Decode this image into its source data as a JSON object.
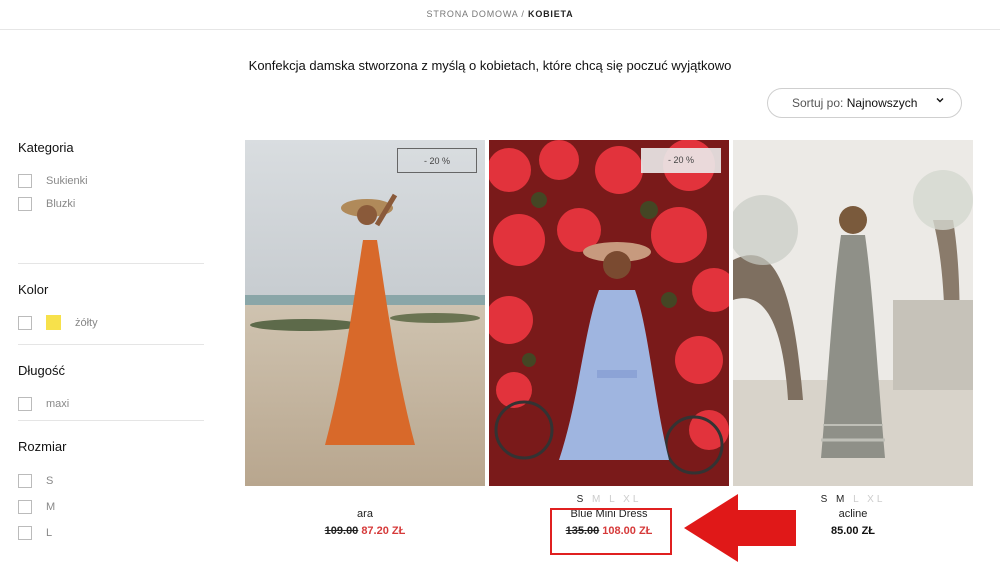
{
  "breadcrumb": {
    "home": "STRONA DOMOWA",
    "separator": "/",
    "current": "KOBIETA"
  },
  "tagline": "Konfekcja damska stworzona z myślą o kobietach, które chcą się poczuć wyjątkowo",
  "sort": {
    "prefix": "Sortuj po:",
    "value": "Najnowszych",
    "icon": "chevron-down-icon"
  },
  "filters": {
    "category": {
      "title": "Kategoria",
      "options": [
        "Sukienki",
        "Bluzki"
      ]
    },
    "color": {
      "title": "Kolor",
      "options": [
        {
          "label": "żółty",
          "swatch": "#f7e14b"
        }
      ]
    },
    "length": {
      "title": "Długość",
      "options": [
        "maxi"
      ]
    },
    "size": {
      "title": "Rozmiar",
      "options": [
        "S",
        "M",
        "L"
      ]
    }
  },
  "products": [
    {
      "name": "ara",
      "badge": "- 20 %",
      "sizes": [],
      "old_price": "109.00",
      "new_price": "87.20 ZŁ"
    },
    {
      "name": "Blue Mini Dress",
      "badge": "- 20 %",
      "sizes": [
        {
          "s": "S",
          "on": true
        },
        {
          "s": "M",
          "on": false
        },
        {
          "s": "L",
          "on": false
        },
        {
          "s": "XL",
          "on": false
        }
      ],
      "old_price": "135.00",
      "new_price": "108.00 ZŁ"
    },
    {
      "name": "acline",
      "badge": "",
      "sizes": [
        {
          "s": "S",
          "on": true
        },
        {
          "s": "M",
          "on": true
        },
        {
          "s": "L",
          "on": false
        },
        {
          "s": "XL",
          "on": false
        }
      ],
      "old_price": "",
      "new_price": "85.00 ZŁ"
    }
  ],
  "colors": {
    "accent_red": "#d63a3a",
    "highlight": "#e02020"
  }
}
